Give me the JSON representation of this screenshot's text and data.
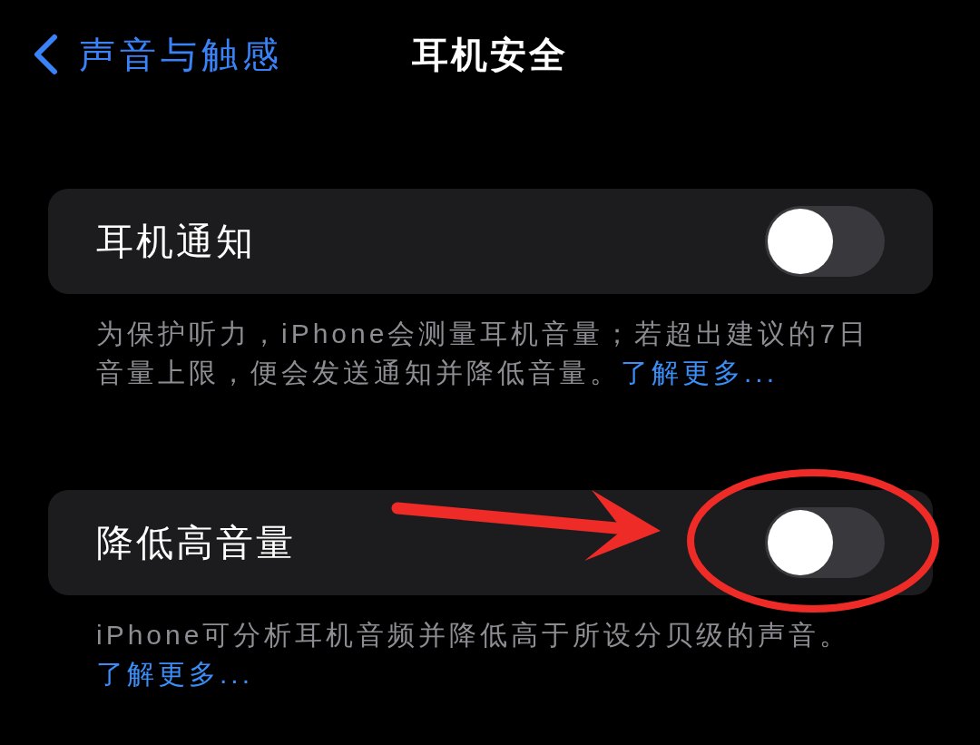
{
  "nav": {
    "back_label": "声音与触感",
    "title": "耳机安全"
  },
  "sections": [
    {
      "label": "耳机通知",
      "on": false,
      "footer": "为保护听力，iPhone会测量耳机音量；若超出建议的7日音量上限，便会发送通知并降低音量。",
      "link": "了解更多..."
    },
    {
      "label": "降低高音量",
      "on": false,
      "footer": "iPhone可分析耳机音频并降低高于所设分贝级的声音。",
      "link": "了解更多..."
    }
  ]
}
